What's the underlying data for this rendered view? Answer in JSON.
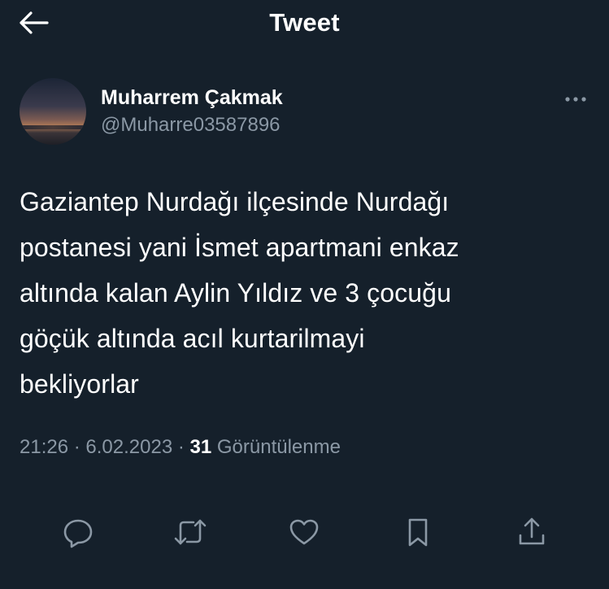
{
  "header": {
    "title": "Tweet",
    "back_icon": "arrow-left-icon"
  },
  "author": {
    "display_name": "Muharrem Çakmak",
    "handle": "@Muharre03587896"
  },
  "tweet": {
    "text_lines": [
      "Gaziantep Nurdağı ilçesinde Nurdağı",
      "postanesi yani İsmet apartmani enkaz",
      "altında kalan Aylin Yıldız ve 3 çocuğu",
      "göçük altında acıl kurtarilmayi",
      "bekliyorlar"
    ]
  },
  "meta": {
    "time": "21:26",
    "separator": " · ",
    "date": "6.02.2023",
    "views_count": "31",
    "views_label": "Görüntülenme"
  },
  "actions": {
    "icons": [
      "reply-icon",
      "retweet-icon",
      "like-icon",
      "bookmark-icon",
      "share-icon"
    ]
  },
  "colors": {
    "background": "#15202b",
    "text_primary": "#ffffff",
    "text_secondary": "#8b98a5"
  }
}
